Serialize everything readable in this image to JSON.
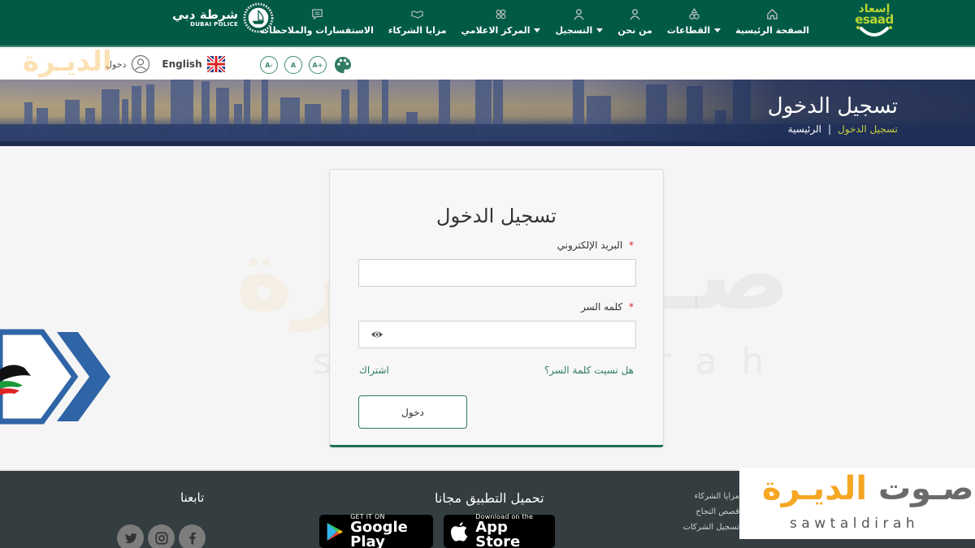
{
  "nav": {
    "items": [
      {
        "label": "الصفحة الرئيسية",
        "icon": "home-icon",
        "dropdown": false
      },
      {
        "label": "القطاعات",
        "icon": "sectors-icon",
        "dropdown": true
      },
      {
        "label": "من نحن",
        "icon": "user-icon",
        "dropdown": false
      },
      {
        "label": "التسجيل",
        "icon": "user-icon",
        "dropdown": true
      },
      {
        "label": "المركز الاعلامي",
        "icon": "grid-icon",
        "dropdown": true
      },
      {
        "label": "مزايا الشركاء",
        "icon": "handshake-icon",
        "dropdown": false
      },
      {
        "label": "الاستفسارات والملاحظات",
        "icon": "chat-icon",
        "dropdown": false
      }
    ],
    "esaad_logo": {
      "arabic": "إسعاد",
      "english": "esaad"
    },
    "police_logo": {
      "arabic": "شرطة دبي",
      "english": "DUBAI POLICE"
    }
  },
  "utility": {
    "login_label": "دخول",
    "language_label": "English",
    "font_buttons": [
      "A-",
      "A",
      "A+"
    ]
  },
  "hero": {
    "title": "تسجيل الدخول",
    "breadcrumb": {
      "home": "الرئيسية",
      "separator": "|",
      "current": "تسجيل الدخول"
    }
  },
  "login": {
    "title": "تسجيل الدخول",
    "email_label": "البريد الإلكتروني",
    "email_value": "",
    "password_label": "كلمه السر",
    "password_value": "",
    "required_mark": "*",
    "forgot_password": "هل نسيت كلمة السر؟",
    "register": "اشتراك",
    "submit": "دخول"
  },
  "footer": {
    "follow_title": "تابعنا",
    "app_title": "تحميل التطبيق مجانا",
    "google_play": {
      "small": "GET IT ON",
      "big": "Google Play"
    },
    "app_store": {
      "small": "Download on the",
      "big": "App Store"
    },
    "links": [
      "مزايا الشركاء",
      "قصص النجاح",
      "تسجيل الشركات"
    ],
    "social": [
      "twitter-icon",
      "instagram-icon",
      "facebook-icon"
    ]
  },
  "watermark": {
    "arabic_orange": "الديـرة",
    "arabic_gray": "صـوت",
    "english": "sawtaldirah"
  },
  "colors": {
    "nav_bg": "#005a45",
    "accent_green": "#2f7a62",
    "lime": "#b9d532",
    "breadcrumb_current": "#c6cf3c",
    "footer_bg": "#343d3f",
    "required": "#d9262b",
    "brand_orange": "#f5a623"
  }
}
